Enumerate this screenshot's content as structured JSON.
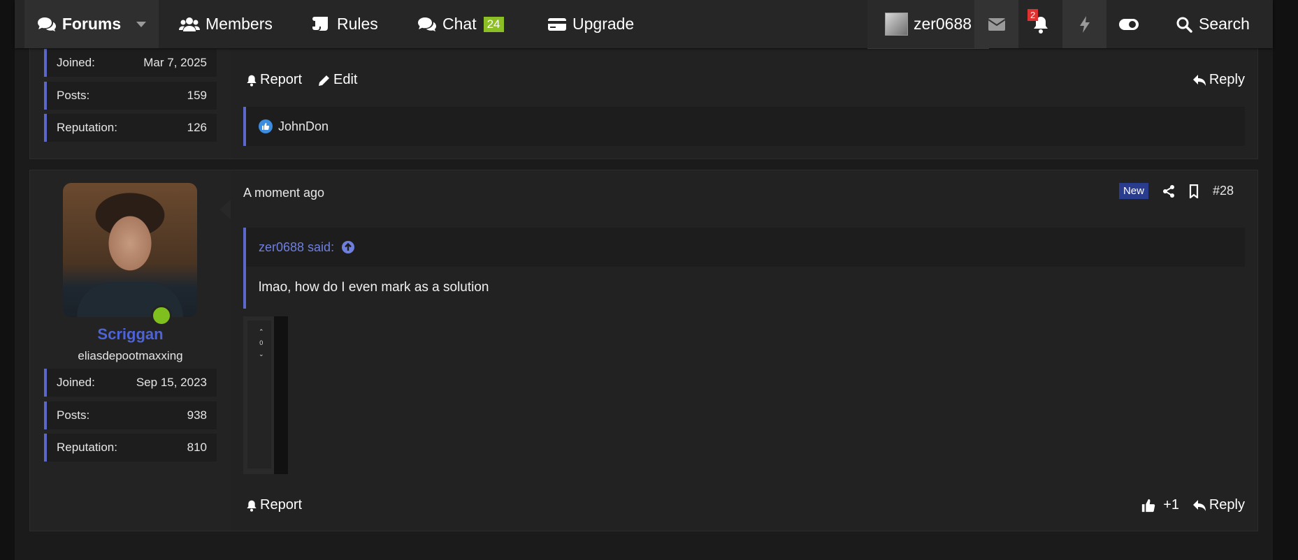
{
  "nav": {
    "forums": "Forums",
    "members": "Members",
    "rules": "Rules",
    "chat": "Chat",
    "chat_badge": "24",
    "upgrade": "Upgrade",
    "username": "zer0688",
    "notification_count": "2",
    "search": "Search"
  },
  "post_top": {
    "stats": [
      {
        "label": "Joined:",
        "value": "Mar 7, 2025"
      },
      {
        "label": "Posts:",
        "value": "159"
      },
      {
        "label": "Reputation:",
        "value": "126"
      }
    ],
    "report": "Report",
    "edit": "Edit",
    "reply": "Reply",
    "liked_by": "JohnDon"
  },
  "post_main": {
    "username": "Scriggan",
    "user_title": "eliasdepootmaxxing",
    "stats": [
      {
        "label": "Joined:",
        "value": "Sep 15, 2023"
      },
      {
        "label": "Posts:",
        "value": "938"
      },
      {
        "label": "Reputation:",
        "value": "810"
      }
    ],
    "time": "A moment ago",
    "new_badge": "New",
    "post_number": "#28",
    "quote_author": "zer0688 said:",
    "quote_text": "lmao, how do I even mark as a solution",
    "embed_vote_count": "0",
    "report": "Report",
    "like_count": "+1",
    "reply": "Reply"
  },
  "colors": {
    "accent": "#5b67c9",
    "username": "#4e63d6",
    "chat_badge": "#8cbf26",
    "online": "#7fbf1e",
    "alert": "#e03131"
  }
}
